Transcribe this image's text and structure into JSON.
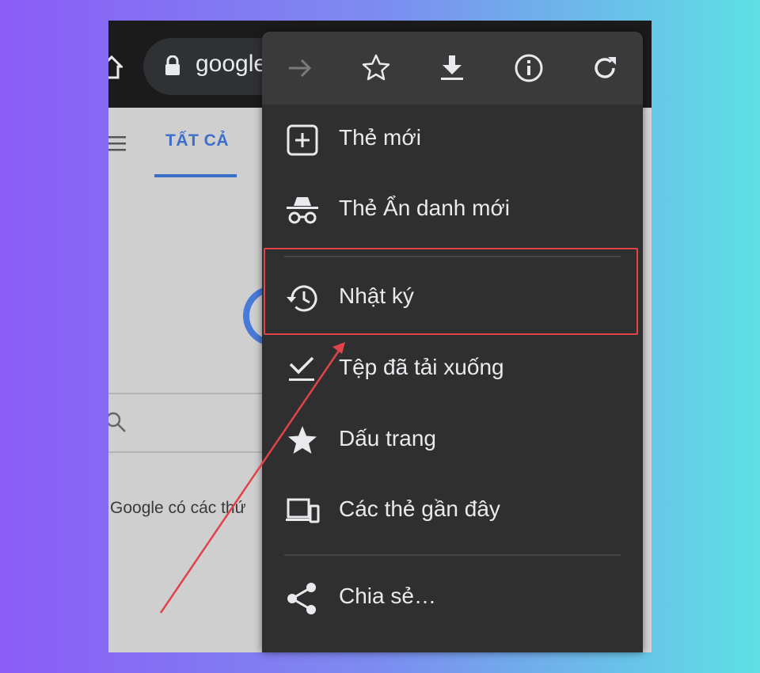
{
  "browser": {
    "url_text": "google",
    "colors": {
      "toolbar_bg": "#1b1b1b",
      "accent": "#3b6fc9",
      "menu_bg": "#2f2f2f",
      "highlight": "#e0434a"
    }
  },
  "page": {
    "tab_all_label": "TẤT CẢ",
    "snippet_text": "Google có các thứ"
  },
  "menu": {
    "toolbar_icons": [
      "forward-icon",
      "bookmark-star-icon",
      "download-icon",
      "info-icon",
      "reload-icon"
    ],
    "items": [
      {
        "label": "Thẻ mới",
        "icon": "new-tab-icon"
      },
      {
        "label": "Thẻ Ẩn danh mới",
        "icon": "incognito-icon"
      },
      {
        "label": "Nhật ký",
        "icon": "history-icon",
        "highlighted": true
      },
      {
        "label": "Tệp đã tải xuống",
        "icon": "downloads-icon"
      },
      {
        "label": "Dấu trang",
        "icon": "bookmarks-icon"
      },
      {
        "label": "Các thẻ gần đây",
        "icon": "recent-tabs-icon"
      },
      {
        "label": "Chia sẻ…",
        "icon": "share-icon"
      }
    ]
  }
}
